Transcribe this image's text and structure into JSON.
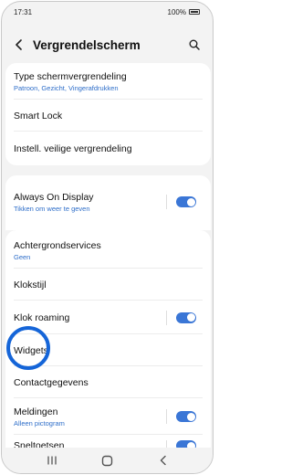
{
  "status_bar": {
    "time": "17:31",
    "battery": "100%"
  },
  "header": {
    "title": "Vergrendelscherm"
  },
  "section1": [
    {
      "label": "Type schermvergrendeling",
      "sub": "Patroon, Gezicht, Vingerafdrukken"
    },
    {
      "label": "Smart Lock"
    },
    {
      "label": "Instell. veilige vergrendeling"
    }
  ],
  "section2": [
    {
      "label": "Always On Display",
      "sub": "Tikken om weer te geven",
      "toggle": true
    }
  ],
  "section3": [
    {
      "label": "Achtergrondservices",
      "sub": "Geen"
    },
    {
      "label": "Klokstijl"
    },
    {
      "label": "Klok roaming",
      "toggle": true
    },
    {
      "label": "Widgets"
    },
    {
      "label": "Contactgegevens"
    },
    {
      "label": "Meldingen",
      "sub": "Alleen pictogram",
      "toggle": true
    },
    {
      "label": "Sneltoetsen",
      "toggle": true
    }
  ],
  "icons": {
    "back": "back-arrow-icon",
    "search": "search-icon",
    "nav_recent": "recent-apps-icon",
    "nav_home": "home-icon",
    "nav_back": "back-icon"
  },
  "colors": {
    "accent": "#3a76d6",
    "highlight_ring": "#1565d8",
    "subtext": "#2e6ec9",
    "background": "#f3f3f3"
  }
}
